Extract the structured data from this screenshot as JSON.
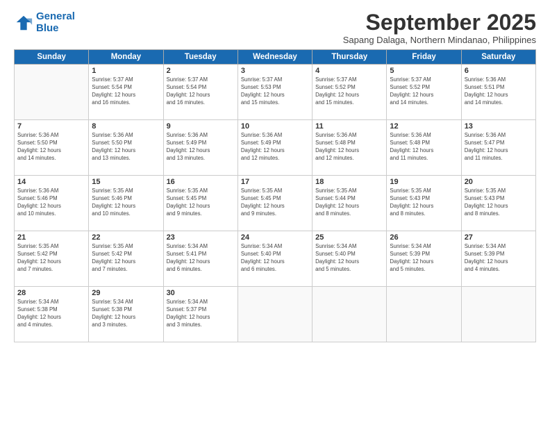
{
  "header": {
    "logo_line1": "General",
    "logo_line2": "Blue",
    "month": "September 2025",
    "location": "Sapang Dalaga, Northern Mindanao, Philippines"
  },
  "weekdays": [
    "Sunday",
    "Monday",
    "Tuesday",
    "Wednesday",
    "Thursday",
    "Friday",
    "Saturday"
  ],
  "weeks": [
    [
      {
        "day": "",
        "info": ""
      },
      {
        "day": "1",
        "info": "Sunrise: 5:37 AM\nSunset: 5:54 PM\nDaylight: 12 hours\nand 16 minutes."
      },
      {
        "day": "2",
        "info": "Sunrise: 5:37 AM\nSunset: 5:54 PM\nDaylight: 12 hours\nand 16 minutes."
      },
      {
        "day": "3",
        "info": "Sunrise: 5:37 AM\nSunset: 5:53 PM\nDaylight: 12 hours\nand 15 minutes."
      },
      {
        "day": "4",
        "info": "Sunrise: 5:37 AM\nSunset: 5:52 PM\nDaylight: 12 hours\nand 15 minutes."
      },
      {
        "day": "5",
        "info": "Sunrise: 5:37 AM\nSunset: 5:52 PM\nDaylight: 12 hours\nand 14 minutes."
      },
      {
        "day": "6",
        "info": "Sunrise: 5:36 AM\nSunset: 5:51 PM\nDaylight: 12 hours\nand 14 minutes."
      }
    ],
    [
      {
        "day": "7",
        "info": "Sunrise: 5:36 AM\nSunset: 5:50 PM\nDaylight: 12 hours\nand 14 minutes."
      },
      {
        "day": "8",
        "info": "Sunrise: 5:36 AM\nSunset: 5:50 PM\nDaylight: 12 hours\nand 13 minutes."
      },
      {
        "day": "9",
        "info": "Sunrise: 5:36 AM\nSunset: 5:49 PM\nDaylight: 12 hours\nand 13 minutes."
      },
      {
        "day": "10",
        "info": "Sunrise: 5:36 AM\nSunset: 5:49 PM\nDaylight: 12 hours\nand 12 minutes."
      },
      {
        "day": "11",
        "info": "Sunrise: 5:36 AM\nSunset: 5:48 PM\nDaylight: 12 hours\nand 12 minutes."
      },
      {
        "day": "12",
        "info": "Sunrise: 5:36 AM\nSunset: 5:48 PM\nDaylight: 12 hours\nand 11 minutes."
      },
      {
        "day": "13",
        "info": "Sunrise: 5:36 AM\nSunset: 5:47 PM\nDaylight: 12 hours\nand 11 minutes."
      }
    ],
    [
      {
        "day": "14",
        "info": "Sunrise: 5:36 AM\nSunset: 5:46 PM\nDaylight: 12 hours\nand 10 minutes."
      },
      {
        "day": "15",
        "info": "Sunrise: 5:35 AM\nSunset: 5:46 PM\nDaylight: 12 hours\nand 10 minutes."
      },
      {
        "day": "16",
        "info": "Sunrise: 5:35 AM\nSunset: 5:45 PM\nDaylight: 12 hours\nand 9 minutes."
      },
      {
        "day": "17",
        "info": "Sunrise: 5:35 AM\nSunset: 5:45 PM\nDaylight: 12 hours\nand 9 minutes."
      },
      {
        "day": "18",
        "info": "Sunrise: 5:35 AM\nSunset: 5:44 PM\nDaylight: 12 hours\nand 8 minutes."
      },
      {
        "day": "19",
        "info": "Sunrise: 5:35 AM\nSunset: 5:43 PM\nDaylight: 12 hours\nand 8 minutes."
      },
      {
        "day": "20",
        "info": "Sunrise: 5:35 AM\nSunset: 5:43 PM\nDaylight: 12 hours\nand 8 minutes."
      }
    ],
    [
      {
        "day": "21",
        "info": "Sunrise: 5:35 AM\nSunset: 5:42 PM\nDaylight: 12 hours\nand 7 minutes."
      },
      {
        "day": "22",
        "info": "Sunrise: 5:35 AM\nSunset: 5:42 PM\nDaylight: 12 hours\nand 7 minutes."
      },
      {
        "day": "23",
        "info": "Sunrise: 5:34 AM\nSunset: 5:41 PM\nDaylight: 12 hours\nand 6 minutes."
      },
      {
        "day": "24",
        "info": "Sunrise: 5:34 AM\nSunset: 5:40 PM\nDaylight: 12 hours\nand 6 minutes."
      },
      {
        "day": "25",
        "info": "Sunrise: 5:34 AM\nSunset: 5:40 PM\nDaylight: 12 hours\nand 5 minutes."
      },
      {
        "day": "26",
        "info": "Sunrise: 5:34 AM\nSunset: 5:39 PM\nDaylight: 12 hours\nand 5 minutes."
      },
      {
        "day": "27",
        "info": "Sunrise: 5:34 AM\nSunset: 5:39 PM\nDaylight: 12 hours\nand 4 minutes."
      }
    ],
    [
      {
        "day": "28",
        "info": "Sunrise: 5:34 AM\nSunset: 5:38 PM\nDaylight: 12 hours\nand 4 minutes."
      },
      {
        "day": "29",
        "info": "Sunrise: 5:34 AM\nSunset: 5:38 PM\nDaylight: 12 hours\nand 3 minutes."
      },
      {
        "day": "30",
        "info": "Sunrise: 5:34 AM\nSunset: 5:37 PM\nDaylight: 12 hours\nand 3 minutes."
      },
      {
        "day": "",
        "info": ""
      },
      {
        "day": "",
        "info": ""
      },
      {
        "day": "",
        "info": ""
      },
      {
        "day": "",
        "info": ""
      }
    ]
  ]
}
